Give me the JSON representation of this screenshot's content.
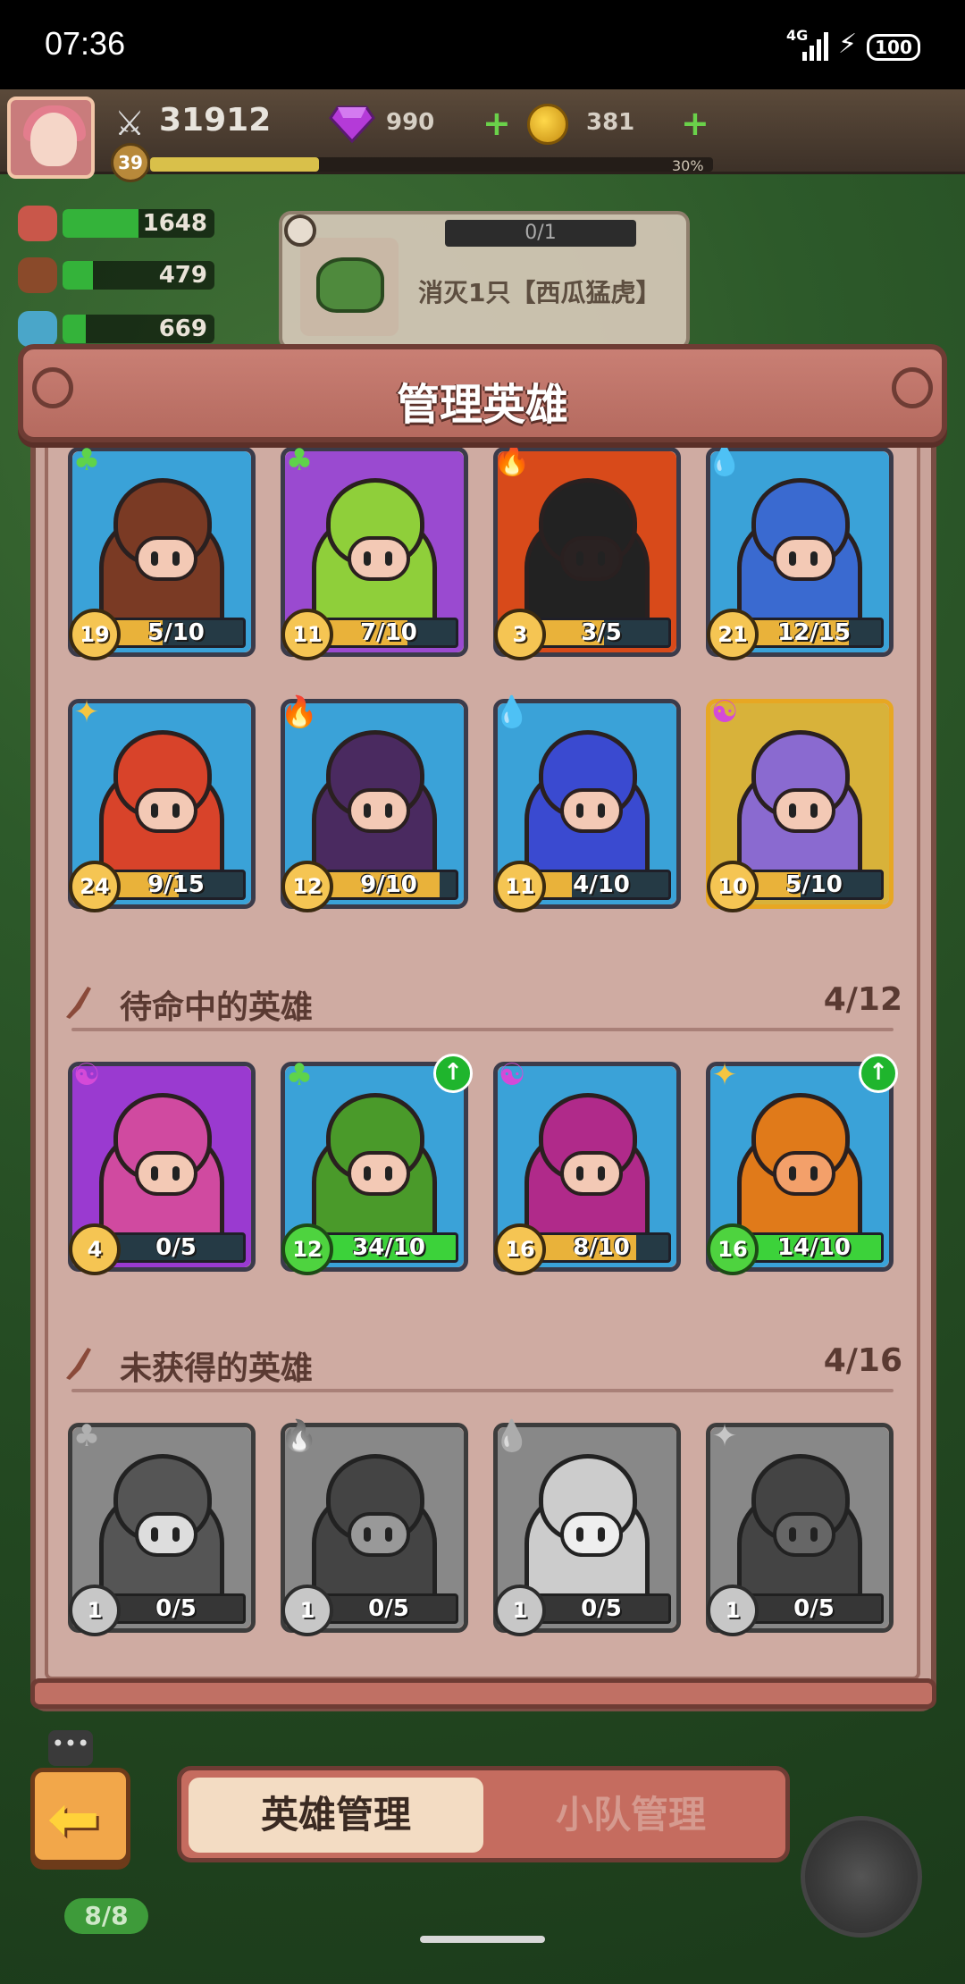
{
  "status_bar": {
    "time": "07:36",
    "network": "4G",
    "battery": "100"
  },
  "hud": {
    "power": "31912",
    "gems": "990",
    "coins": "381",
    "level": "39",
    "xp_percent_label": "30%",
    "xp_progress": 0.3,
    "resources": [
      {
        "name": "meat",
        "value": "1648",
        "fill": 0.5,
        "color": "#c9574a"
      },
      {
        "name": "wood",
        "value": "479",
        "fill": 0.2,
        "color": "#8a4a2a"
      },
      {
        "name": "crystal",
        "value": "669",
        "fill": 0.15,
        "color": "#4aa6c9"
      }
    ]
  },
  "quest": {
    "progress": "0/1",
    "text": "消灭1只【西瓜猛虎】"
  },
  "panel": {
    "title": "管理英雄"
  },
  "sections": {
    "standby": {
      "label": "待命中的英雄",
      "count": "4/12"
    },
    "unowned": {
      "label": "未获得的英雄",
      "count": "4/16"
    }
  },
  "heroes_active": [
    {
      "level": "19",
      "progress": "5/10",
      "fill": 0.5,
      "element": "nature-icon",
      "bg": "#3aa2d8",
      "accent": "#7a3a24",
      "face": "#f3c9b5"
    },
    {
      "level": "11",
      "progress": "7/10",
      "fill": 0.7,
      "element": "nature-icon",
      "bg": "#9a4ad0",
      "accent": "#8fcf3a",
      "face": "#f3c9b5"
    },
    {
      "level": "3",
      "progress": "3/5",
      "fill": 0.6,
      "element": "fire-icon",
      "bg": "#d84a1a",
      "accent": "#222222",
      "face": "#2a2222"
    },
    {
      "level": "21",
      "progress": "12/15",
      "fill": 0.8,
      "element": "water-icon",
      "bg": "#3aa2d8",
      "accent": "#3a6ad0",
      "face": "#f3c9b5"
    },
    {
      "level": "24",
      "progress": "9/15",
      "fill": 0.6,
      "element": "light-icon",
      "bg": "#3aa2d8",
      "accent": "#d8432a",
      "face": "#f3c9b5"
    },
    {
      "level": "12",
      "progress": "9/10",
      "fill": 0.9,
      "element": "fire-icon",
      "bg": "#3aa2d8",
      "accent": "#4a2a60",
      "face": "#f3c9b5"
    },
    {
      "level": "11",
      "progress": "4/10",
      "fill": 0.4,
      "element": "water-icon",
      "bg": "#3aa2d8",
      "accent": "#3a4ad0",
      "face": "#f3c9b5"
    },
    {
      "level": "10",
      "progress": "5/10",
      "fill": 0.5,
      "element": "dark-icon",
      "bg": "#d8b23a",
      "accent": "#8a6ad0",
      "face": "#f3c9b5",
      "gold": true
    }
  ],
  "heroes_standby": [
    {
      "level": "4",
      "progress": "0/5",
      "fill": 0.0,
      "element": "dark-icon",
      "bg": "#9a3ad0",
      "accent": "#d04aa0",
      "face": "#f3c9b5"
    },
    {
      "level": "12",
      "progress": "34/10",
      "fill": 1.0,
      "element": "nature-icon",
      "bg": "#3aa2d8",
      "accent": "#4a9a2a",
      "face": "#f3c9b5",
      "upgrade": true
    },
    {
      "level": "16",
      "progress": "8/10",
      "fill": 0.8,
      "element": "dark-icon",
      "bg": "#3aa2d8",
      "accent": "#b02a8a",
      "face": "#f3c9b5"
    },
    {
      "level": "16",
      "progress": "14/10",
      "fill": 1.0,
      "element": "light-icon",
      "bg": "#3aa2d8",
      "accent": "#e07a1a",
      "face": "#f3a06a",
      "upgrade": true
    }
  ],
  "heroes_unowned": [
    {
      "level": "1",
      "progress": "0/5",
      "fill": 0.0,
      "element": "nature-icon",
      "bg": "#888888",
      "accent": "#555555",
      "face": "#dddddd"
    },
    {
      "level": "1",
      "progress": "0/5",
      "fill": 0.0,
      "element": "fire-icon",
      "bg": "#888888",
      "accent": "#444444",
      "face": "#999999"
    },
    {
      "level": "1",
      "progress": "0/5",
      "fill": 0.0,
      "element": "water-icon",
      "bg": "#888888",
      "accent": "#cccccc",
      "face": "#eeeeee"
    },
    {
      "level": "1",
      "progress": "0/5",
      "fill": 0.0,
      "element": "light-icon",
      "bg": "#888888",
      "accent": "#444444",
      "face": "#666666"
    }
  ],
  "element_glyphs": {
    "nature-icon": "♣",
    "fire-icon": "🔥",
    "water-icon": "💧",
    "light-icon": "✦",
    "dark-icon": "☯"
  },
  "element_colors": {
    "nature-icon": "#5fd34a",
    "fire-icon": "#ff7a2a",
    "water-icon": "#3ab0ff",
    "light-icon": "#f5c542",
    "dark-icon": "#d44ad8"
  },
  "tabs": {
    "active": "英雄管理",
    "inactive": "小队管理"
  },
  "squad_count": "8/8"
}
